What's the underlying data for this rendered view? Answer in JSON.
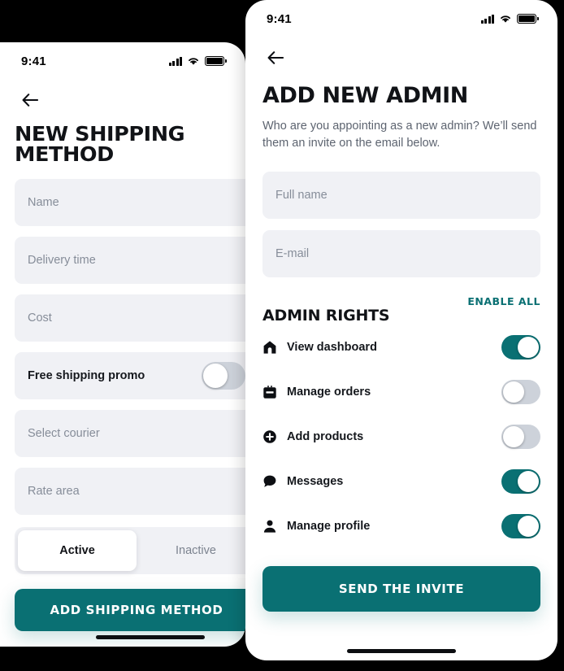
{
  "left_screen": {
    "status": {
      "time": "9:41",
      "signal_icon": "signal-bars-icon",
      "wifi_icon": "wifi-icon",
      "battery_icon": "battery-icon"
    },
    "back_icon": "back-arrow-icon",
    "title": "NEW SHIPPING METHOD",
    "fields": [
      {
        "placeholder": "Name",
        "type": "text",
        "name": "name"
      },
      {
        "placeholder": "Delivery time",
        "type": "text",
        "name": "delivery-time"
      },
      {
        "placeholder": "Cost",
        "type": "text",
        "name": "cost"
      }
    ],
    "promo_row": {
      "label": "Free shipping promo",
      "toggle_on": false
    },
    "fields2": [
      {
        "placeholder": "Select courier",
        "type": "select",
        "name": "select-courier"
      },
      {
        "placeholder": "Rate area",
        "type": "select",
        "name": "rate-area"
      }
    ],
    "segmented": {
      "options": [
        "Active",
        "Inactive"
      ],
      "selected": "Active"
    },
    "submit_label": "ADD SHIPPING METHOD"
  },
  "right_screen": {
    "status": {
      "time": "9:41",
      "signal_icon": "signal-bars-icon",
      "wifi_icon": "wifi-icon",
      "battery_icon": "battery-icon"
    },
    "back_icon": "back-arrow-icon",
    "title": "ADD NEW ADMIN",
    "subtitle": "Who are you appointing as a new admin? We’ll send them an invite on the email below.",
    "fields": [
      {
        "placeholder": "Full name",
        "name": "full-name"
      },
      {
        "placeholder": "E-mail",
        "name": "email"
      }
    ],
    "rights_section": {
      "title": "ADMIN RIGHTS",
      "enable_all_label": "ENABLE ALL",
      "rows": [
        {
          "label": "View dashboard",
          "icon": "home-icon",
          "toggle_on": true
        },
        {
          "label": "Manage orders",
          "icon": "briefcase-icon",
          "toggle_on": false
        },
        {
          "label": "Add products",
          "icon": "plus-circle-icon",
          "toggle_on": false
        },
        {
          "label": "Messages",
          "icon": "chat-bubble-icon",
          "toggle_on": true
        },
        {
          "label": "Manage profile",
          "icon": "person-icon",
          "toggle_on": true
        }
      ]
    },
    "submit_label": "SEND THE INVITE"
  },
  "colors": {
    "accent": "#0a7073",
    "field_bg": "#f0f1f5",
    "placeholder": "#868d99",
    "text": "#111317",
    "muted": "#5d6470",
    "toggle_off": "#cdd2da"
  }
}
